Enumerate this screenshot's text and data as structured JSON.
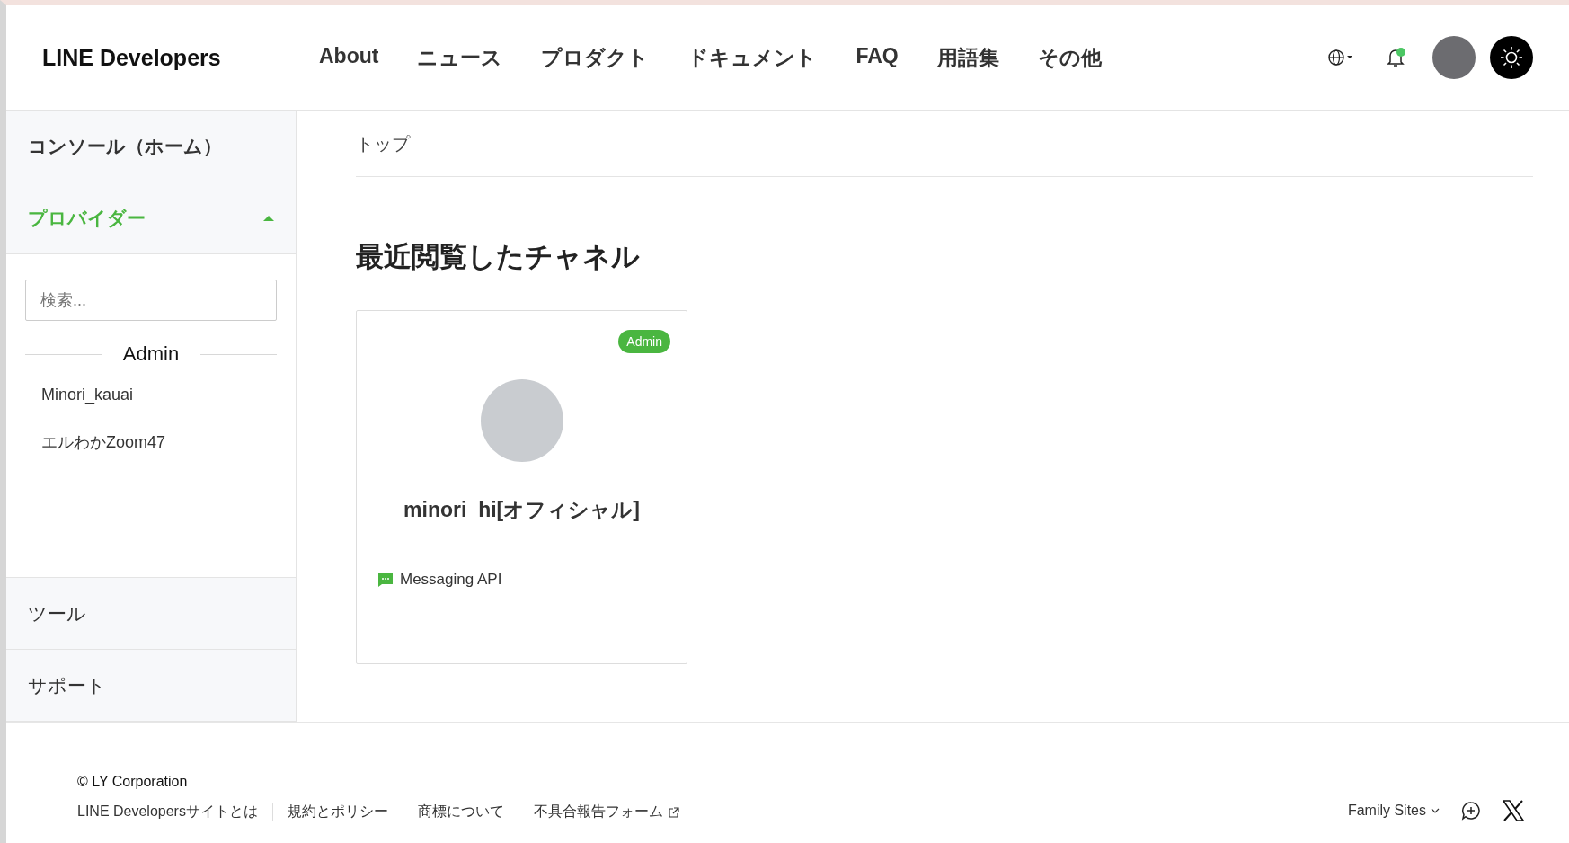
{
  "header": {
    "logo": "LINE Developers",
    "nav": [
      {
        "label": "About"
      },
      {
        "label": "ニュース"
      },
      {
        "label": "プロダクト"
      },
      {
        "label": "ドキュメント"
      },
      {
        "label": "FAQ"
      },
      {
        "label": "用語集"
      },
      {
        "label": "その他"
      }
    ],
    "has_notification": true
  },
  "sidebar": {
    "items": [
      {
        "kind": "link",
        "label": "コンソール（ホーム）"
      },
      {
        "kind": "section",
        "label": "プロバイダー",
        "expanded": true,
        "search_placeholder": "検索...",
        "group_label": "Admin",
        "providers": [
          "Minori_kauai",
          "エルわかZoom47"
        ]
      },
      {
        "kind": "link",
        "label": "ツール"
      },
      {
        "kind": "link",
        "label": "サポート"
      }
    ]
  },
  "breadcrumb": "トップ",
  "heading": "最近閲覧したチャネル",
  "channels": [
    {
      "role_badge": "Admin",
      "name": "minori_hi[オフィシャル]",
      "type": "Messaging API"
    }
  ],
  "footer": {
    "copyright": "© LY Corporation",
    "links": [
      {
        "label": "LINE Developersサイトとは",
        "external": false
      },
      {
        "label": "規約とポリシー",
        "external": false
      },
      {
        "label": "商標について",
        "external": false
      },
      {
        "label": "不具合報告フォーム",
        "external": true
      }
    ],
    "family_sites": "Family Sites"
  }
}
